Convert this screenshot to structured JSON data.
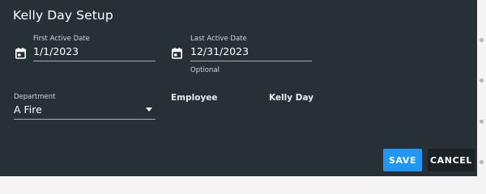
{
  "dialog": {
    "title": "Kelly Day Setup"
  },
  "first_active_date": {
    "label": "First Active Date",
    "value": "1/1/2023",
    "icon": "calendar-icon"
  },
  "last_active_date": {
    "label": "Last Active Date",
    "value": "12/31/2023",
    "hint": "Optional",
    "icon": "calendar-icon"
  },
  "department": {
    "label": "Department",
    "selected": "A Fire",
    "icon": "dropdown-arrow-icon"
  },
  "columns": {
    "employee": "Employee",
    "kelly_day": "Kelly Day"
  },
  "actions": {
    "save": "SAVE",
    "cancel": "CANCEL"
  },
  "colors": {
    "dialog_bg": "#263035",
    "primary": "#2196f3"
  }
}
